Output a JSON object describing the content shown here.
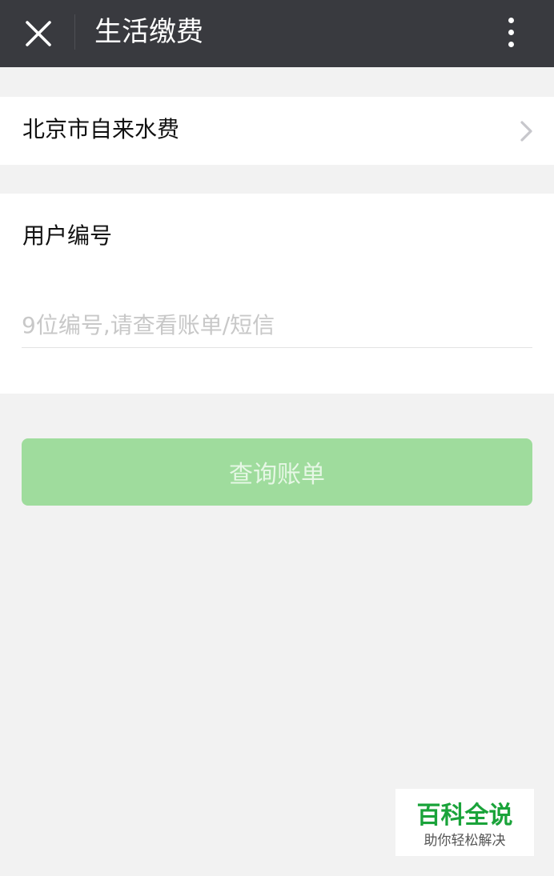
{
  "header": {
    "title": "生活缴费",
    "close_icon": "close-icon",
    "more_icon": "more-vertical-icon",
    "background": "#393a3f"
  },
  "provider": {
    "label": "北京市自来水费",
    "chevron_icon": "chevron-right-icon"
  },
  "form": {
    "field_label": "用户编号",
    "input_value": "",
    "input_placeholder": "9位编号,请查看账单/短信"
  },
  "actions": {
    "query_label": "查询账单",
    "query_color": "#9fdc9d"
  },
  "watermark": {
    "title": "百科全说",
    "subtitle": "助你轻松解决"
  }
}
